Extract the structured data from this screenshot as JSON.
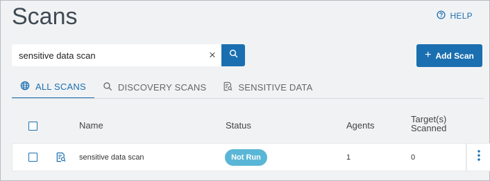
{
  "page": {
    "title": "Scans",
    "help_label": "HELP"
  },
  "search": {
    "value": "sensitive data scan",
    "clear_glyph": "×"
  },
  "toolbar": {
    "add_label": "Add Scan",
    "add_icon": "+"
  },
  "tabs": [
    {
      "label": "ALL SCANS",
      "icon": "globe-icon",
      "active": true
    },
    {
      "label": "DISCOVERY SCANS",
      "icon": "search-icon",
      "active": false
    },
    {
      "label": "SENSITIVE DATA",
      "icon": "document-search-icon",
      "active": false
    }
  ],
  "table": {
    "columns": {
      "name": "Name",
      "status": "Status",
      "agents": "Agents",
      "target_line1": "Target(s)",
      "target_line2": "Scanned"
    },
    "rows": [
      {
        "name": "sensitive data scan",
        "status": "Not Run",
        "agents": "1",
        "target_scanned": "0",
        "icon": "document-search-icon"
      }
    ]
  },
  "colors": {
    "accent": "#1a6fb0",
    "status_not_run": "#5ab6d6",
    "background": "#f1f2f4"
  }
}
